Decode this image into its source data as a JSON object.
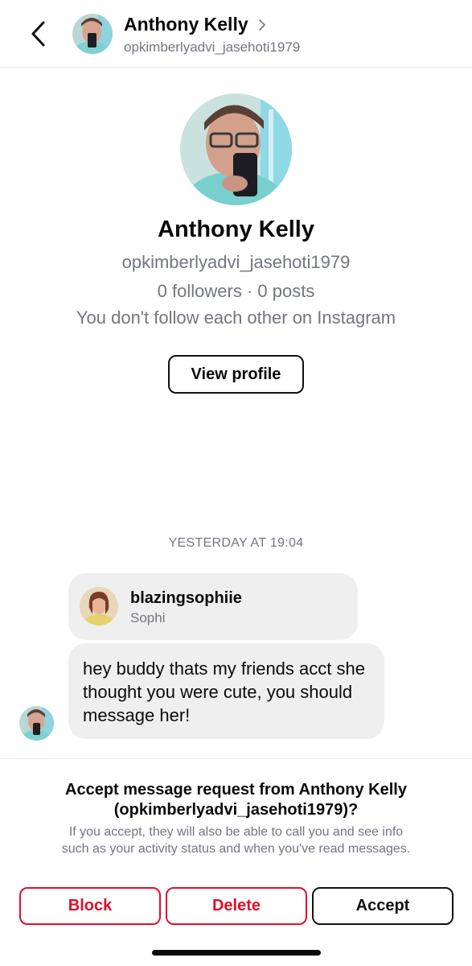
{
  "header": {
    "name": "Anthony Kelly",
    "username": "opkimberlyadvi_jasehoti1979",
    "back_icon": "chevron-left-icon",
    "name_chevron_icon": "chevron-right-icon"
  },
  "profile": {
    "name": "Anthony Kelly",
    "username": "opkimberlyadvi_jasehoti1979",
    "stats": "0 followers · 0 posts",
    "follow_status": "You don't follow each other on Instagram",
    "view_profile_label": "View profile"
  },
  "thread": {
    "timestamp": "YESTERDAY AT 19:04",
    "shared_profile": {
      "username": "blazingsophiie",
      "name": "Sophi"
    },
    "message": "hey buddy thats my friends acct she thought you were cute, you should message her!"
  },
  "request": {
    "title_line1": "Accept message request from Anthony Kelly",
    "title_line2": "(opkimberlyadvi_jasehoti1979)?",
    "desc_line1": "If you accept, they will also be able to call you and see info",
    "desc_line2": "such as your activity status and when you've read messages.",
    "block_label": "Block",
    "delete_label": "Delete",
    "accept_label": "Accept"
  },
  "colors": {
    "danger": "#e0102b",
    "muted_text": "#737680",
    "bubble": "#efefef"
  }
}
